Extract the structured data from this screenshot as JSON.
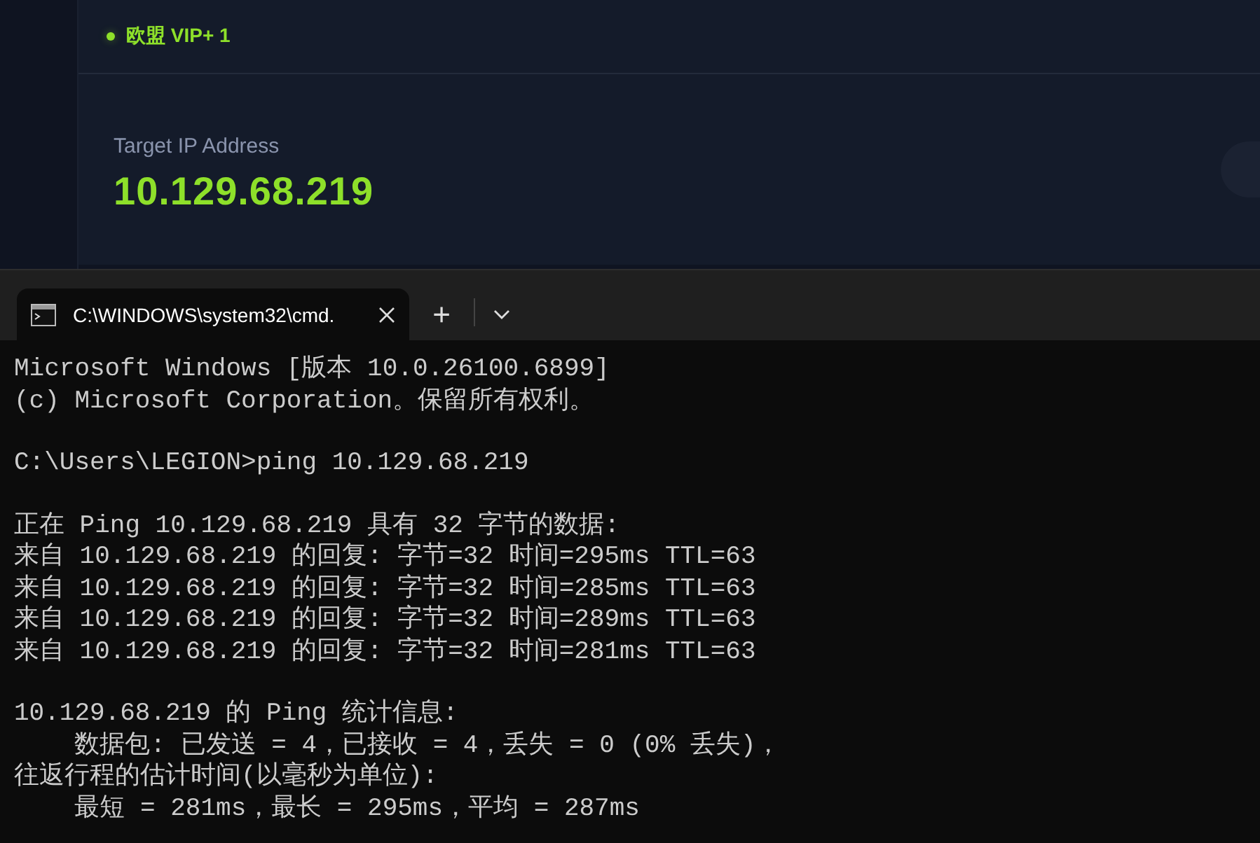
{
  "server_tag": {
    "label": "欧盟 VIP+ 1",
    "online": true
  },
  "target": {
    "label": "Target IP Address",
    "ip": "10.129.68.219"
  },
  "terminal": {
    "tab": {
      "title": "C:\\WINDOWS\\system32\\cmd.",
      "selected": true
    },
    "new_tab": "+",
    "blocks": [
      [
        "Microsoft Windows [版本 10.0.26100.6899]",
        "(c) Microsoft Corporation。保留所有权利。"
      ],
      [
        "C:\\Users\\LEGION>ping 10.129.68.219"
      ],
      [
        "正在 Ping 10.129.68.219 具有 32 字节的数据:",
        "来自 10.129.68.219 的回复: 字节=32 时间=295ms TTL=63",
        "来自 10.129.68.219 的回复: 字节=32 时间=285ms TTL=63",
        "来自 10.129.68.219 的回复: 字节=32 时间=289ms TTL=63",
        "来自 10.129.68.219 的回复: 字节=32 时间=281ms TTL=63"
      ],
      [
        "10.129.68.219 的 Ping 统计信息:",
        "    数据包: 已发送 = 4，已接收 = 4，丢失 = 0 (0% 丢失)，",
        "往返行程的估计时间(以毫秒为单位):",
        "    最短 = 281ms，最长 = 295ms，平均 = 287ms"
      ]
    ]
  }
}
